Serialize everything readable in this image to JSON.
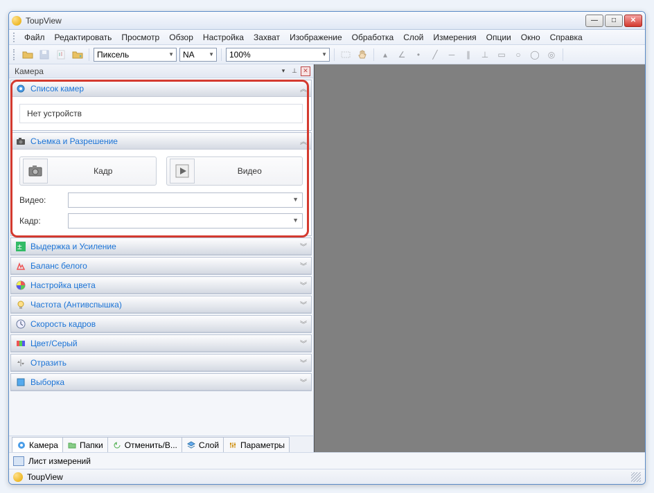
{
  "title": "ToupView",
  "menu": [
    "Файл",
    "Редактировать",
    "Просмотр",
    "Обзор",
    "Настройка",
    "Захват",
    "Изображение",
    "Обработка",
    "Слой",
    "Измерения",
    "Опции",
    "Окно",
    "Справка"
  ],
  "toolbar": {
    "unit": "Пиксель",
    "na": "NA",
    "zoom": "100%"
  },
  "sidebar": {
    "header": "Камера",
    "panels": {
      "camera_list": {
        "title": "Список камер",
        "empty_text": "Нет устройств"
      },
      "capture": {
        "title": "Съемка и Разрешение",
        "frame_btn": "Кадр",
        "video_btn": "Видео",
        "video_label": "Видео:",
        "frame_label": "Кадр:"
      },
      "exposure": {
        "title": "Выдержка и Усиление"
      },
      "wb": {
        "title": "Баланс белого"
      },
      "color": {
        "title": "Настройка цвета"
      },
      "freq": {
        "title": "Частота (Антивспышка)"
      },
      "fps": {
        "title": "Скорость кадров"
      },
      "graycolor": {
        "title": "Цвет/Серый"
      },
      "flip": {
        "title": "Отразить"
      },
      "sample": {
        "title": "Выборка"
      }
    },
    "tabs": {
      "camera": "Камера",
      "folders": "Папки",
      "undo": "Отменить/В...",
      "layer": "Слой",
      "params": "Параметры"
    }
  },
  "sheet_bar": "Лист измерений",
  "status": "ToupView"
}
